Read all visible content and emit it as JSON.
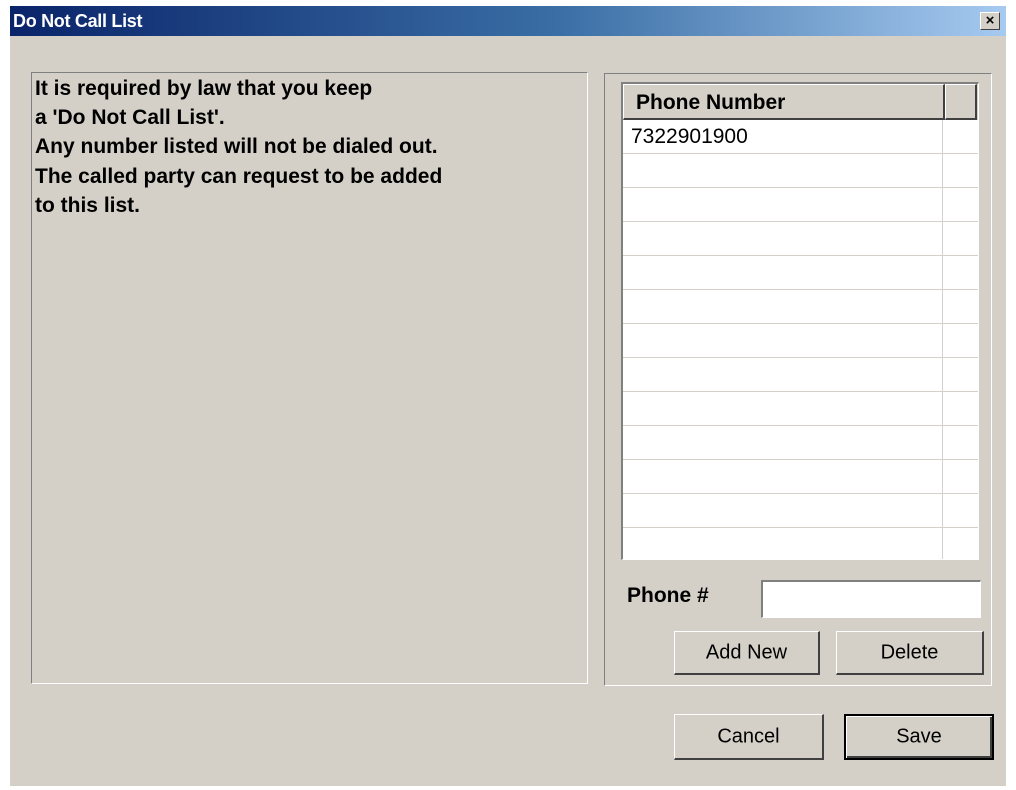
{
  "window": {
    "title": "Do Not Call List",
    "close_symbol": "×"
  },
  "info": {
    "lines": [
      "It is required by law that you keep",
      "a 'Do Not Call List'.",
      "Any number listed will not be dialed out.",
      "The called party can request to be added",
      "to this list."
    ]
  },
  "grid": {
    "column_header": "Phone Number",
    "rows": [
      "7322901900",
      "",
      "",
      "",
      "",
      "",
      "",
      "",
      "",
      "",
      "",
      "",
      ""
    ]
  },
  "phone_field": {
    "label": "Phone #",
    "value": ""
  },
  "buttons": {
    "add_new": "Add New",
    "delete": "Delete",
    "cancel": "Cancel",
    "save": "Save"
  },
  "icons": {
    "close": "close-icon"
  },
  "colors": {
    "title_bar_start": "#0a246a",
    "title_bar_end": "#a6caf0",
    "window_face": "#d4d0c8"
  }
}
